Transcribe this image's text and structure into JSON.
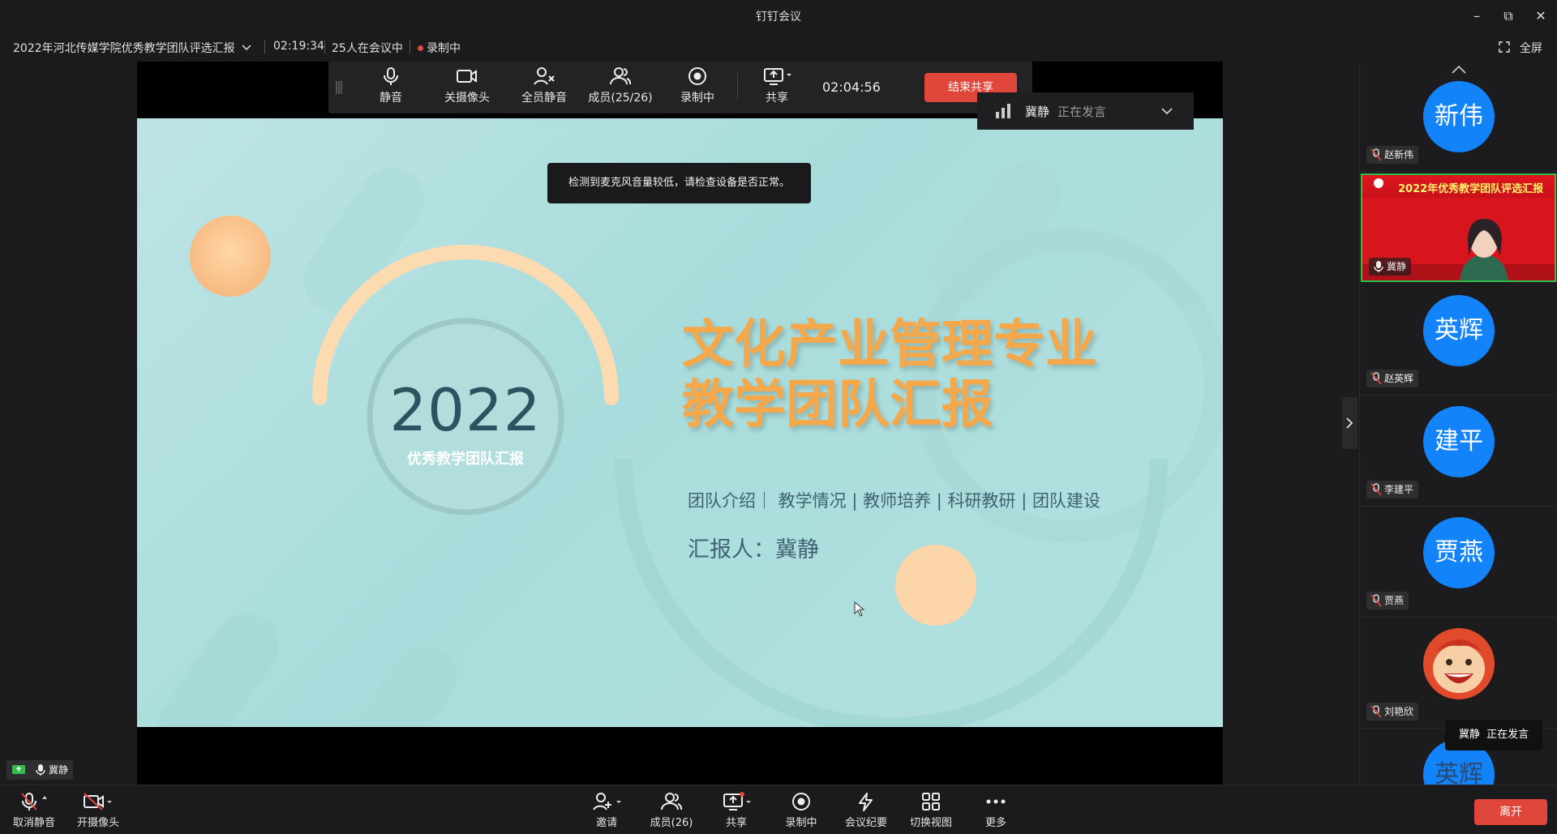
{
  "window": {
    "title": "钉钉会议"
  },
  "infobar": {
    "meeting_name": "2022年河北传媒学院优秀教学团队评选汇报",
    "elapsed": "02:19:34",
    "participants_status": "25人在会议中",
    "recording_status": "录制中",
    "fullscreen_label": "全屏"
  },
  "share_toolbar": {
    "items": [
      "静音",
      "关摄像头",
      "全员静音",
      "成员(25/26)",
      "录制中",
      "共享"
    ],
    "share_timer": "02:04:56",
    "end_share_label": "结束共享"
  },
  "speaking_banner": {
    "name": "冀静",
    "status": "正在发言"
  },
  "mic_tooltip": "检测到麦克风音量较低，请检查设备是否正常。",
  "slide": {
    "year": "2022",
    "year_subtitle": "优秀教学团队汇报",
    "title_line1": "文化产业管理专业",
    "title_line2": "教学团队汇报",
    "topics": "团队介绍｜ 教学情况 | 教师培养 | 科研教研 | 团队建设",
    "presenter": "汇报人：冀静"
  },
  "participants": [
    {
      "avatar_text": "新伟",
      "name": "赵新伟"
    },
    {
      "video_title": "2022年优秀教学团队评选汇报",
      "name": "冀静"
    },
    {
      "avatar_text": "英辉",
      "name": "赵英辉"
    },
    {
      "avatar_text": "建平",
      "name": "李建平"
    },
    {
      "avatar_text": "贾燕",
      "name": "贾燕"
    },
    {
      "name": "刘艳欣"
    },
    {
      "avatar_text": "英辉"
    }
  ],
  "speaking_popup": {
    "name": "冀静",
    "status": "正在发言"
  },
  "self_tag": {
    "name": "冀静"
  },
  "bottombar": {
    "left": [
      "取消静音",
      "开摄像头"
    ],
    "center": [
      "邀请",
      "成员(26)",
      "共享",
      "录制中",
      "会议纪要",
      "切换视图",
      "更多"
    ],
    "leave_label": "离开"
  },
  "colors": {
    "accent_red": "#e0463a",
    "avatar_blue": "#1283f8",
    "slide_bg": "#b3e1df",
    "slide_title": "#f5a84a"
  }
}
